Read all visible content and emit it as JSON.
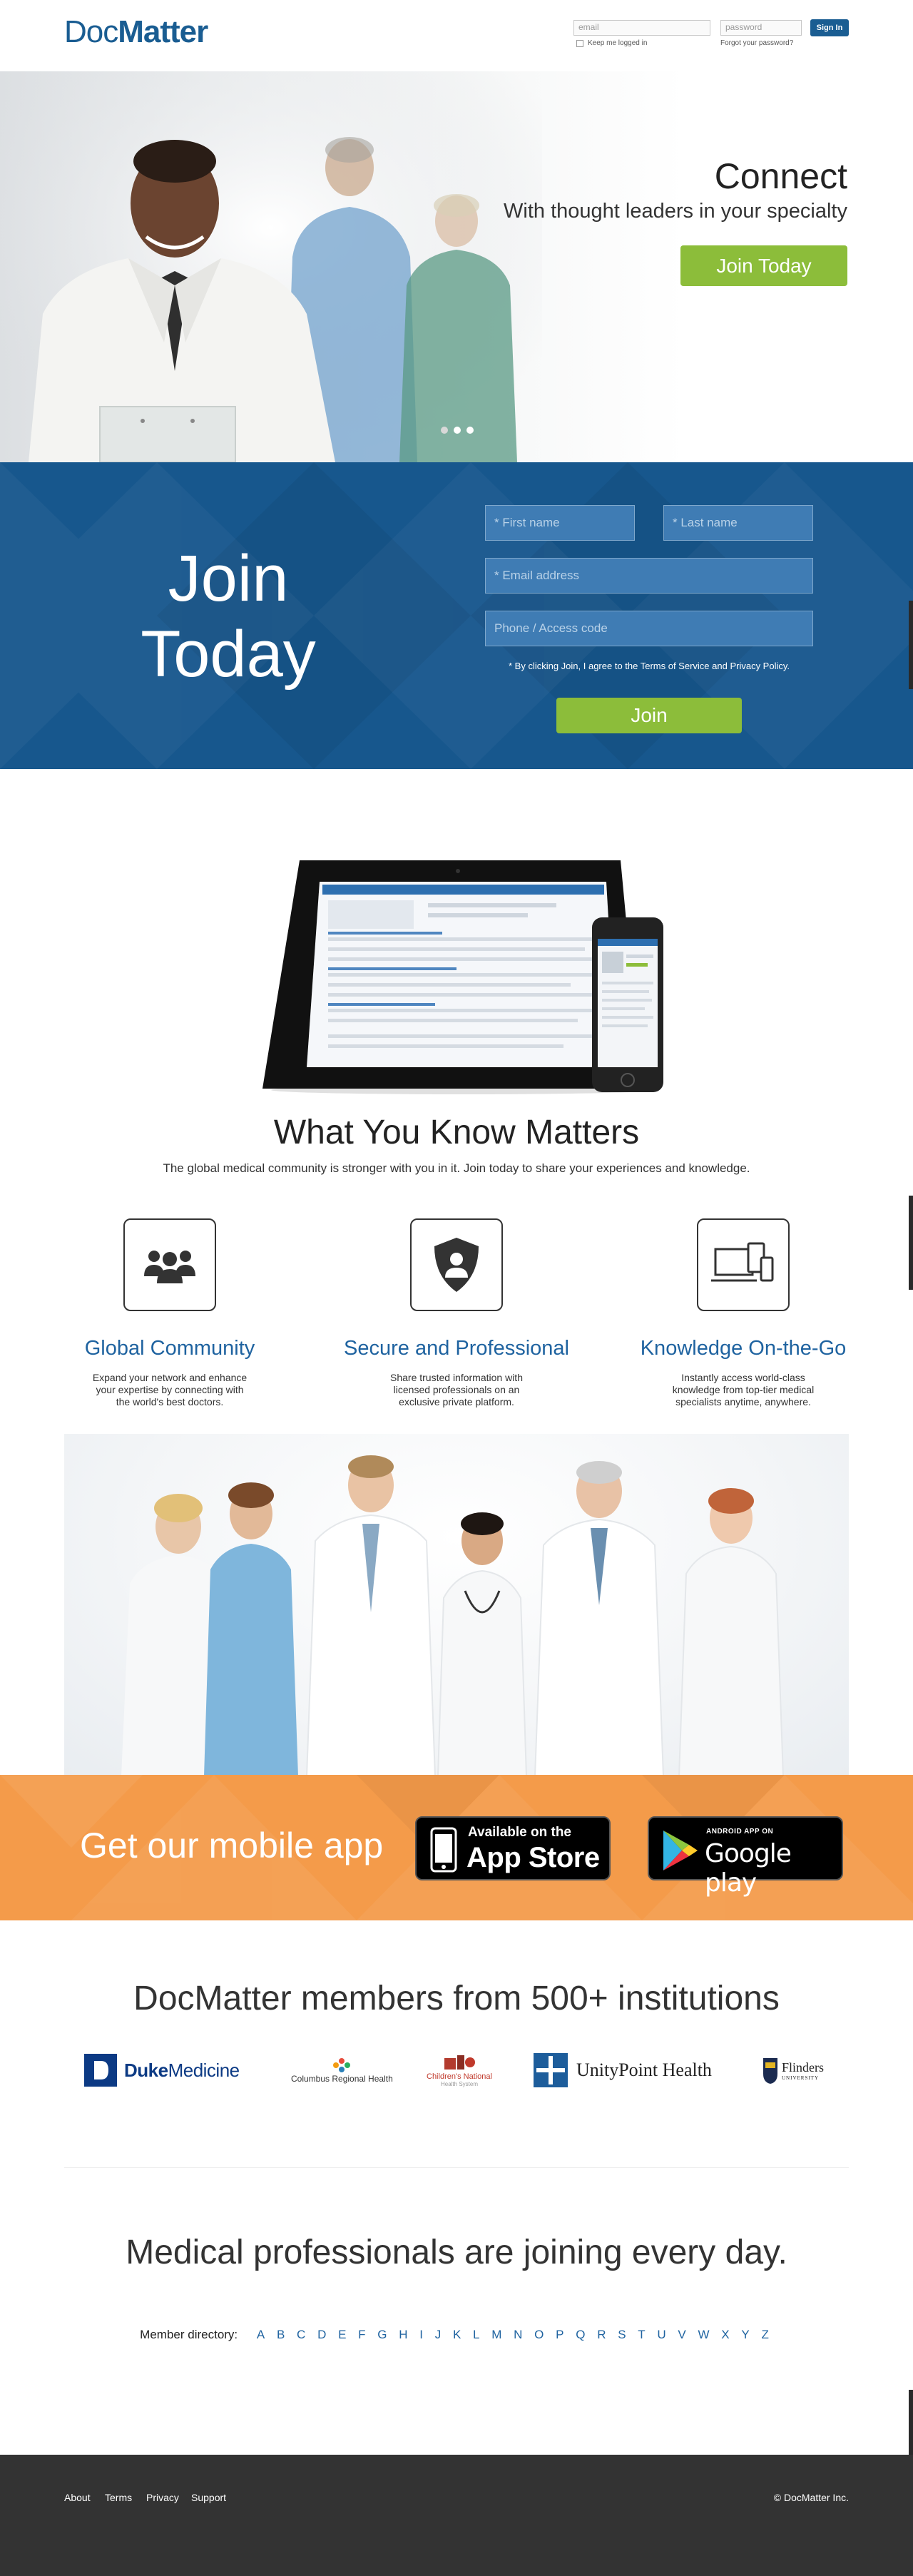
{
  "header": {
    "logo_prefix": "Doc",
    "logo_suffix": "Matter",
    "email_placeholder": "email",
    "password_placeholder": "password",
    "signin_label": "Sign In",
    "keep_logged_in": "Keep me logged in",
    "forgot_password": "Forgot your password?"
  },
  "hero": {
    "title": "Connect",
    "subtitle": "With thought leaders in your specialty",
    "cta_label": "Join Today",
    "slide_count": 3,
    "active_slide": 1
  },
  "join": {
    "title_line1": "Join",
    "title_line2": "Today",
    "first_name_placeholder": "* First name",
    "last_name_placeholder": "* Last name",
    "email_placeholder": "* Email address",
    "phone_placeholder": "Phone / Access code",
    "terms": "* By clicking Join, I agree to the Terms of Service and Privacy Policy.",
    "button_label": "Join"
  },
  "what_you_know": {
    "title": "What You Know Matters",
    "subtitle": "The global medical community is stronger with you in it. Join today to share your experiences and knowledge."
  },
  "features": [
    {
      "icon": "people-group-icon",
      "title": "Global Community",
      "description": "Expand your network and enhance your expertise by connecting with the world's best doctors."
    },
    {
      "icon": "shield-user-icon",
      "title": "Secure and Professional",
      "description": "Share trusted information with licensed professionals on an exclusive private platform."
    },
    {
      "icon": "devices-icon",
      "title": "Knowledge On-the-Go",
      "description": "Instantly access world-class knowledge from top-tier medical specialists anytime, anywhere."
    }
  ],
  "mobile_app": {
    "title": "Get our mobile app",
    "appstore_small": "Available on the",
    "appstore_big": "App Store",
    "google_small": "ANDROID APP ON",
    "google_big": "Google play"
  },
  "institutions": {
    "title": "DocMatter members from 500+ institutions",
    "logos": [
      {
        "name_bold": "Duke",
        "name_rest": "Medicine"
      },
      {
        "name": "Columbus Regional Health"
      },
      {
        "name": "Children's National",
        "tagline": "Health System"
      },
      {
        "name": "UnityPoint Health"
      },
      {
        "name": "Flinders",
        "tagline": "UNIVERSITY"
      }
    ]
  },
  "directory": {
    "title": "Medical professionals are joining every day.",
    "label": "Member directory:",
    "letters": [
      "A",
      "B",
      "C",
      "D",
      "E",
      "F",
      "G",
      "H",
      "I",
      "J",
      "K",
      "L",
      "M",
      "N",
      "O",
      "P",
      "Q",
      "R",
      "S",
      "T",
      "U",
      "V",
      "W",
      "X",
      "Y",
      "Z"
    ]
  },
  "footer": {
    "links": [
      "About",
      "Terms",
      "Privacy",
      "Support"
    ],
    "copyright": "© DocMatter Inc."
  },
  "colors": {
    "brand_blue": "#1a5d92",
    "join_blue": "#17578d",
    "cta_green": "#8cbd3a",
    "app_orange": "#f49b4a",
    "link_blue": "#1f63a0",
    "footer_gray": "#333333"
  }
}
